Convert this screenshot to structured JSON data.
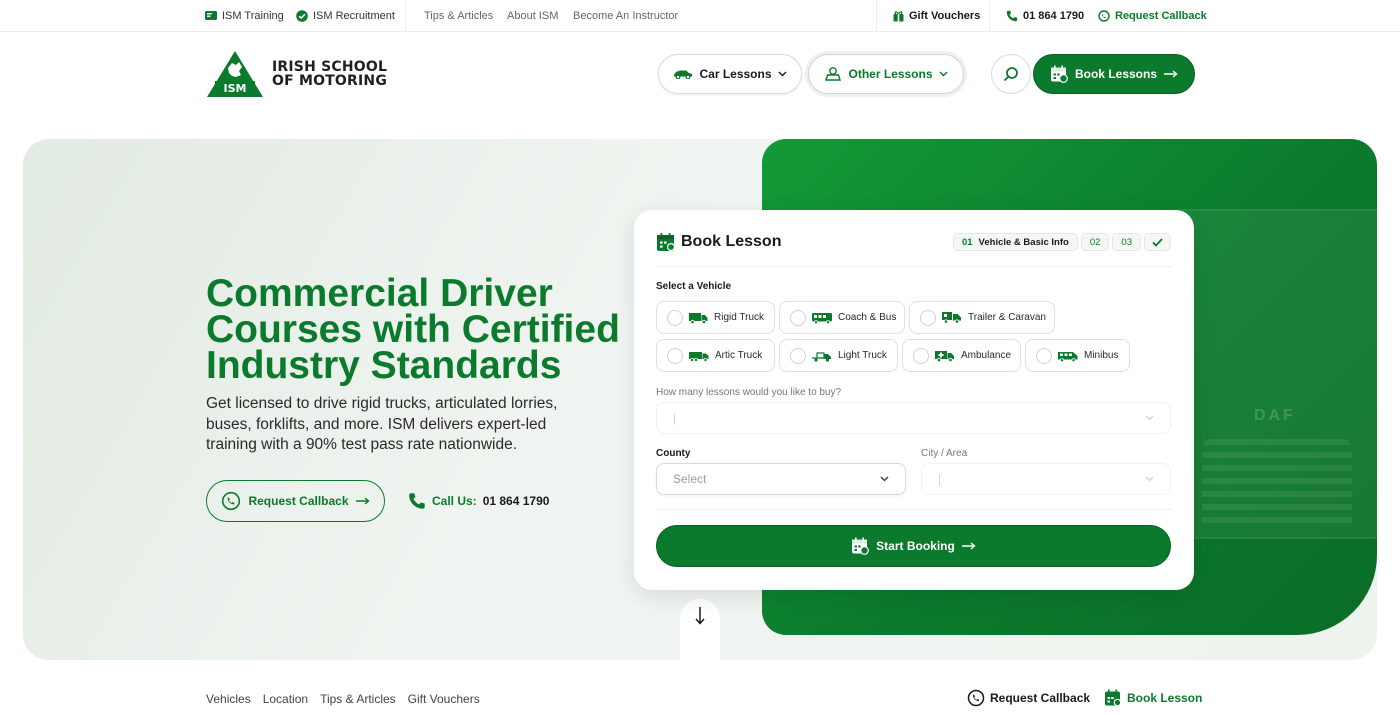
{
  "topbar": {
    "ism_training": "ISM Training",
    "ism_recruitment": "ISM Recruitment",
    "tips_articles": "Tips & Articles",
    "about_ism": "About ISM",
    "become_instructor": "Become An Instructor",
    "gift_vouchers": "Gift Vouchers",
    "phone": "01 864 1790",
    "request_callback": "Request Callback"
  },
  "header": {
    "logo_line1": "IRISH SCHOOL",
    "logo_line2": "OF MOTORING",
    "logo_badge": "ISM",
    "car_lessons": "Car Lessons",
    "other_lessons": "Other Lessons",
    "book_lessons": "Book Lessons"
  },
  "hero": {
    "title": "Commercial Driver Courses with Certified Industry Standards",
    "subtitle": "Get licensed to drive rigid trucks, articulated lorries, buses, forklifts, and more. ISM delivers expert-led training with a 90% test pass rate nationwide.",
    "request_callback": "Request Callback",
    "call_label": "Call Us:",
    "call_number": "01 864 1790",
    "truck_brand": "DAF"
  },
  "booking": {
    "title": "Book Lesson",
    "steps": [
      {
        "num": "01",
        "label": "Vehicle & Basic Info"
      },
      {
        "num": "02"
      },
      {
        "num": "03"
      }
    ],
    "select_vehicle_label": "Select a Vehicle",
    "vehicles": [
      {
        "label": "Rigid Truck",
        "icon": "rigid-truck-icon"
      },
      {
        "label": "Coach & Bus",
        "icon": "bus-icon"
      },
      {
        "label": "Trailer & Caravan",
        "icon": "trailer-icon"
      },
      {
        "label": "Artic Truck",
        "icon": "artic-truck-icon"
      },
      {
        "label": "Light Truck",
        "icon": "light-truck-icon"
      },
      {
        "label": "Ambulance",
        "icon": "ambulance-icon"
      },
      {
        "label": "Minibus",
        "icon": "minibus-icon"
      }
    ],
    "lessons_label": "How many lessons would you like to buy?",
    "lessons_value": "|",
    "county_label": "County",
    "county_placeholder": "Select",
    "city_label": "City / Area",
    "city_value": "|",
    "start_button": "Start Booking"
  },
  "bottom": {
    "nav": [
      "Vehicles",
      "Location",
      "Tips & Articles",
      "Gift Vouchers"
    ],
    "request_callback": "Request Callback",
    "book_lesson": "Book Lesson"
  },
  "colors": {
    "brand_green": "#0b7a2c",
    "hero_bg": "#e7eee7"
  }
}
